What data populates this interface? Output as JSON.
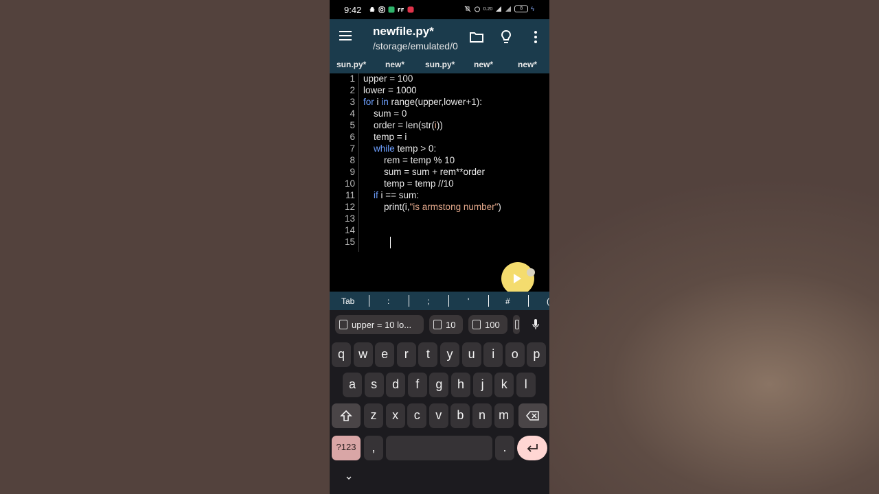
{
  "status": {
    "time": "9:42",
    "net": "0.20",
    "battery": "8"
  },
  "app": {
    "title": "newfile.py*",
    "subtitle": "/storage/emulated/0"
  },
  "tabs": [
    "sun.py*",
    "new*",
    "sun.py*",
    "new*",
    "new*"
  ],
  "code_lines": [
    {
      "n": "1",
      "parts": [
        {
          "t": "upper = 100"
        }
      ]
    },
    {
      "n": "2",
      "parts": [
        {
          "t": "lower = 1000"
        }
      ]
    },
    {
      "n": "3",
      "parts": [
        {
          "t": "for",
          "c": "kw"
        },
        {
          "t": " i "
        },
        {
          "t": "in",
          "c": "kw"
        },
        {
          "t": " range(upper,lower+1):"
        }
      ]
    },
    {
      "n": "4",
      "parts": [
        {
          "t": "    sum = 0"
        }
      ]
    },
    {
      "n": "5",
      "parts": [
        {
          "t": "    order = len(str("
        },
        {
          "t": "i",
          "c": "var"
        },
        {
          "t": "))"
        }
      ]
    },
    {
      "n": "6",
      "parts": [
        {
          "t": "    temp = i"
        }
      ]
    },
    {
      "n": "7",
      "parts": [
        {
          "t": "    "
        },
        {
          "t": "while",
          "c": "kw"
        },
        {
          "t": " temp > 0:"
        }
      ]
    },
    {
      "n": "8",
      "parts": [
        {
          "t": "        rem = temp % 10"
        }
      ]
    },
    {
      "n": "9",
      "parts": [
        {
          "t": "        sum = sum + rem**order"
        }
      ]
    },
    {
      "n": "10",
      "parts": [
        {
          "t": "        temp = temp //10"
        }
      ]
    },
    {
      "n": "11",
      "parts": [
        {
          "t": "    "
        },
        {
          "t": "if",
          "c": "kw"
        },
        {
          "t": " i == sum:"
        }
      ]
    },
    {
      "n": "12",
      "parts": [
        {
          "t": "        print(i,"
        },
        {
          "t": "\"is armstong number\"",
          "c": "str"
        },
        {
          "t": ")"
        }
      ]
    },
    {
      "n": "13",
      "parts": []
    },
    {
      "n": "14",
      "parts": []
    },
    {
      "n": "15",
      "parts": []
    }
  ],
  "symbols": [
    "Tab",
    ":",
    ";",
    "'",
    "#",
    "("
  ],
  "clipboard": [
    "upper = 10 lo...",
    "10",
    "100"
  ],
  "keys": {
    "row1": [
      "q",
      "w",
      "e",
      "r",
      "t",
      "y",
      "u",
      "i",
      "o",
      "p"
    ],
    "row2": [
      "a",
      "s",
      "d",
      "f",
      "g",
      "h",
      "j",
      "k",
      "l"
    ],
    "row3": [
      "z",
      "x",
      "c",
      "v",
      "b",
      "n",
      "m"
    ],
    "num_label": "?123",
    "comma": ",",
    "period": "."
  }
}
